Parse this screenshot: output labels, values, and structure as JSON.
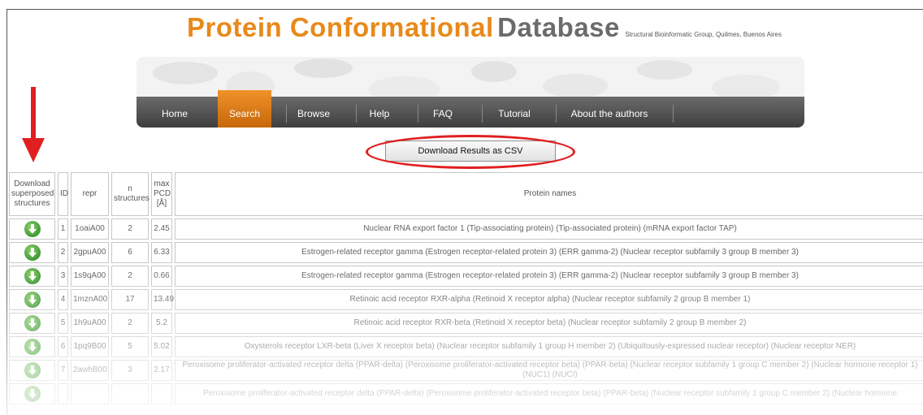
{
  "header": {
    "title_part1": "Protein Conformational",
    "title_part2": "Database",
    "subtitle": "Structural Bioinformatic Group, Quilmes, Buenos Aires"
  },
  "nav": {
    "items": [
      {
        "label": "Home",
        "active": false
      },
      {
        "label": "Search",
        "active": true
      },
      {
        "label": "Browse",
        "active": false
      },
      {
        "label": "Help",
        "active": false
      },
      {
        "label": "FAQ",
        "active": false
      },
      {
        "label": "Tutorial",
        "active": false
      },
      {
        "label": "About the authors",
        "active": false
      }
    ]
  },
  "toolbar": {
    "download_csv_label": "Download Results as CSV"
  },
  "colors": {
    "accent_orange": "#e8891a",
    "annotation_red": "#e02020",
    "download_green": "#3f9a32"
  },
  "table": {
    "headers": {
      "download": "Download superposed structures",
      "id": "ID",
      "repr": "repr",
      "n_structures": "n structures",
      "max_pcd": "max PCD [Å]",
      "names": "Protein names"
    },
    "rows": [
      {
        "id": "1",
        "repr": "1oaiA00",
        "n": "2",
        "pcd": "2.45",
        "name": "Nuclear RNA export factor 1 (Tip-associating protein) (Tip-associated protein) (mRNA export factor TAP)"
      },
      {
        "id": "2",
        "repr": "2gpuA00",
        "n": "6",
        "pcd": "6.33",
        "name": "Estrogen-related receptor gamma (Estrogen receptor-related protein 3) (ERR gamma-2) (Nuclear receptor subfamily 3 group B member 3)"
      },
      {
        "id": "3",
        "repr": "1s9qA00",
        "n": "2",
        "pcd": "0.66",
        "name": "Estrogen-related receptor gamma (Estrogen receptor-related protein 3) (ERR gamma-2) (Nuclear receptor subfamily 3 group B member 3)"
      },
      {
        "id": "4",
        "repr": "1mznA00",
        "n": "17",
        "pcd": "13.49",
        "name": "Retinoic acid receptor RXR-alpha (Retinoid X receptor alpha) (Nuclear receptor subfamily 2 group B member 1)"
      },
      {
        "id": "5",
        "repr": "1h9uA00",
        "n": "2",
        "pcd": "5.2",
        "name": "Retinoic acid receptor RXR-beta (Retinoid X receptor beta) (Nuclear receptor subfamily 2 group B member 2)"
      },
      {
        "id": "6",
        "repr": "1pq9B00",
        "n": "5",
        "pcd": "5.02",
        "name": "Oxysterols receptor LXR-beta (Liver X receptor beta) (Nuclear receptor subfamily 1 group H member 2) (Ubiquitously-expressed nuclear receptor) (Nuclear receptor NER)"
      },
      {
        "id": "7",
        "repr": "2awhB00",
        "n": "3",
        "pcd": "2.17",
        "name": "Peroxisome proliferator-activated receptor delta (PPAR-delta) (Peroxisome proliferator-activated receptor beta) (PPAR-beta) (Nuclear receptor subfamily 1 group C member 2) (Nuclear hormone receptor 1) (NUC1) (NUCI)"
      },
      {
        "id": "",
        "repr": "",
        "n": "",
        "pcd": "",
        "name": "Peroxisome proliferator-activated receptor delta (PPAR-delta) (Peroxisome proliferator-activated receptor beta) (PPAR-beta) (Nuclear receptor subfamily 1 group C member 2) (Nuclear hormone"
      }
    ]
  }
}
